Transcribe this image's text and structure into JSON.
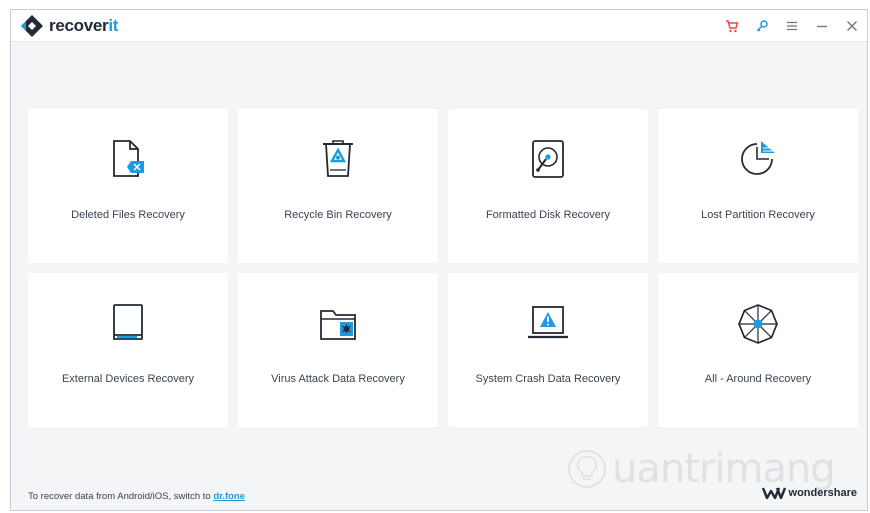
{
  "app": {
    "name_main": "recover",
    "name_accent": "it"
  },
  "titlebar": {
    "icons": [
      "cart-icon",
      "key-icon",
      "menu-icon",
      "minimize-icon",
      "close-icon"
    ]
  },
  "colors": {
    "accent": "#1d9be0",
    "cart": "#e8474c",
    "icon_dark": "#222a35"
  },
  "cards": [
    {
      "label": "Deleted Files Recovery",
      "icon": "deleted-file-icon"
    },
    {
      "label": "Recycle Bin Recovery",
      "icon": "recycle-bin-icon"
    },
    {
      "label": "Formatted Disk Recovery",
      "icon": "hard-disk-icon"
    },
    {
      "label": "Lost Partition Recovery",
      "icon": "partition-pie-icon"
    },
    {
      "label": "External Devices Recovery",
      "icon": "external-device-icon"
    },
    {
      "label": "Virus Attack Data Recovery",
      "icon": "virus-folder-icon"
    },
    {
      "label": "System Crash Data Recovery",
      "icon": "laptop-warning-icon"
    },
    {
      "label": "All - Around Recovery",
      "icon": "all-around-icon"
    }
  ],
  "footer": {
    "text": "To recover data from Android/iOS, switch to",
    "link": "dr.fone",
    "brand": "wondershare"
  },
  "watermark": {
    "text": "uantrimang"
  }
}
